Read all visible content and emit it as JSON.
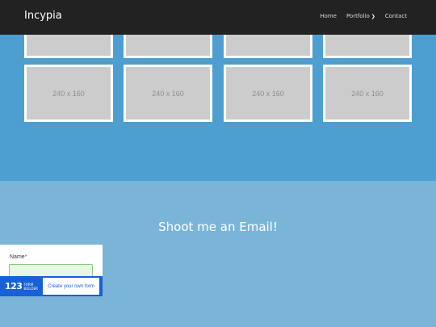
{
  "navbar": {
    "brand": "Incypia",
    "links": [
      {
        "label": "Home"
      },
      {
        "label": "Portfolio"
      },
      {
        "label": "Contact"
      }
    ]
  },
  "portfolio": {
    "thumbnails": [
      {
        "label": "240 x 160"
      },
      {
        "label": "240 x 160"
      },
      {
        "label": "240 x 160"
      },
      {
        "label": "240 x 160"
      }
    ]
  },
  "contact": {
    "title": "Shoot me an Email!"
  },
  "form": {
    "name_label": "Name",
    "required_mark": "*",
    "name_value": ""
  },
  "form_builder": {
    "logo_number": "123",
    "logo_line1": "FORM",
    "logo_line2": "BUILDER",
    "cta": "Create your own form"
  },
  "colors": {
    "navbar": "#222222",
    "portfolio_bg": "#4d9fd2",
    "contact_bg": "#7ab5d8",
    "form_builder": "#1760d8"
  }
}
